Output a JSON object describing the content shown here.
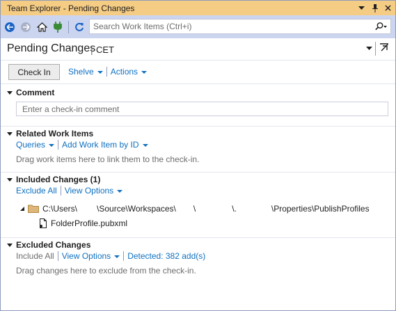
{
  "window": {
    "title": "Team Explorer - Pending Changes",
    "pin_glyph": "▾ ⊥",
    "close_glyph": "✕"
  },
  "toolbar": {
    "search_placeholder": "Search Work Items (Ctrl+i)"
  },
  "header": {
    "title": "Pending Changes",
    "separator": "|",
    "project": "CET"
  },
  "actions": {
    "checkin_label": "Check In",
    "shelve_label": "Shelve",
    "actions_label": "Actions"
  },
  "comment": {
    "title": "Comment",
    "placeholder": "Enter a check-in comment"
  },
  "related": {
    "title": "Related Work Items",
    "queries_label": "Queries",
    "add_item_label": "Add Work Item by ID",
    "hint": "Drag work items here to link them to the check-in."
  },
  "included": {
    "title": "Included Changes (1)",
    "exclude_all_label": "Exclude All",
    "view_options_label": "View Options",
    "path_parts": [
      "C:\\Users\\",
      "\\Source\\Workspaces\\",
      "\\",
      "\\.",
      "\\Properties\\PublishProfiles"
    ],
    "file_name": "FolderProfile.pubxml"
  },
  "excluded": {
    "title": "Excluded Changes",
    "include_all_label": "Include All",
    "view_options_label": "View Options",
    "detected_label": "Detected: 382 add(s)",
    "hint": "Drag changes here to exclude from the check-in."
  },
  "colors": {
    "title_bar": "#f5cc84",
    "toolbar": "#ccd5f0",
    "link": "#0e70c0",
    "hint": "#6d6d6d"
  }
}
